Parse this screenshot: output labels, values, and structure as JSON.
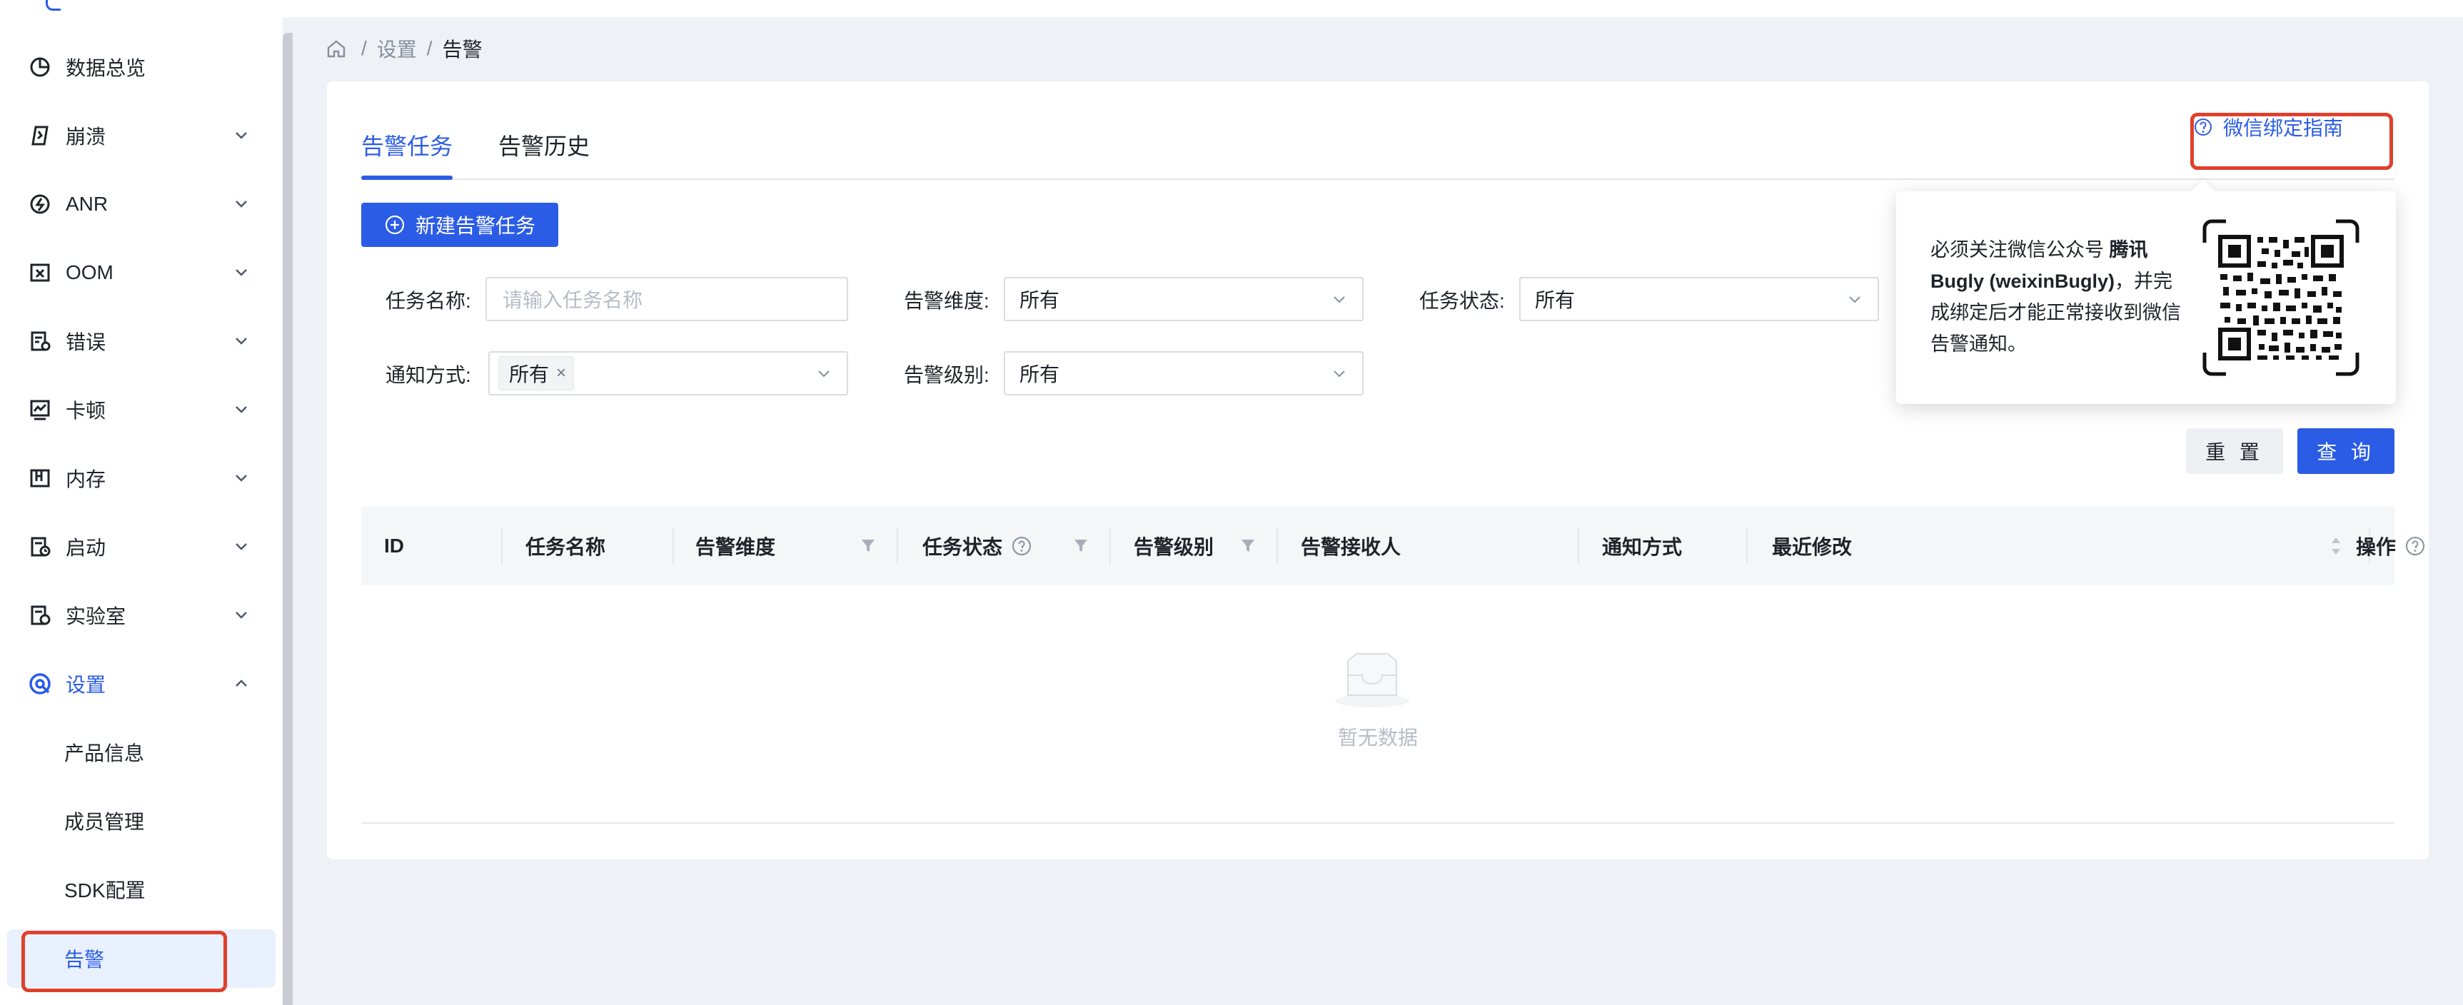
{
  "sidebar": {
    "items": [
      {
        "label": "数据总览",
        "icon": "pie-chart-icon"
      },
      {
        "label": "崩溃",
        "icon": "crash-icon"
      },
      {
        "label": "ANR",
        "icon": "anr-icon"
      },
      {
        "label": "OOM",
        "icon": "oom-icon"
      },
      {
        "label": "错误",
        "icon": "error-icon"
      },
      {
        "label": "卡顿",
        "icon": "lag-icon"
      },
      {
        "label": "内存",
        "icon": "memory-icon"
      },
      {
        "label": "启动",
        "icon": "launch-icon"
      },
      {
        "label": "实验室",
        "icon": "lab-icon"
      },
      {
        "label": "设置",
        "icon": "settings-icon"
      }
    ],
    "sub_items": [
      {
        "label": "产品信息"
      },
      {
        "label": "成员管理"
      },
      {
        "label": "SDK配置"
      },
      {
        "label": "告警"
      }
    ]
  },
  "breadcrumb": {
    "level1": "设置",
    "level2": "告警",
    "separator": "/"
  },
  "tabs": [
    {
      "label": "告警任务",
      "active": true
    },
    {
      "label": "告警历史",
      "active": false
    }
  ],
  "guide_link": "微信绑定指南",
  "new_task_button": "新建告警任务",
  "filters": {
    "task_name": {
      "label": "任务名称:",
      "placeholder": "请输入任务名称"
    },
    "dimension": {
      "label": "告警维度:",
      "value": "所有"
    },
    "status": {
      "label": "任务状态:",
      "value": "所有"
    },
    "notify": {
      "label": "通知方式:",
      "tag": "所有",
      "tag_close": "×"
    },
    "level": {
      "label": "告警级别:",
      "value": "所有"
    }
  },
  "buttons": {
    "reset": "重 置",
    "query": "查 询"
  },
  "table": {
    "columns": [
      "ID",
      "任务名称",
      "告警维度",
      "任务状态",
      "告警级别",
      "告警接收人",
      "通知方式",
      "最近修改",
      "操作"
    ],
    "empty_text": "暂无数据"
  },
  "popover": {
    "text_before": "必须关注微信公众号 ",
    "account": "腾讯Bugly (weixinBugly)",
    "text_after": "，并完成绑定后才能正常接收到微信告警通知。"
  },
  "colors": {
    "primary": "#2b5ce6",
    "highlight": "#e0402b",
    "page_bg": "#eef1f6"
  }
}
